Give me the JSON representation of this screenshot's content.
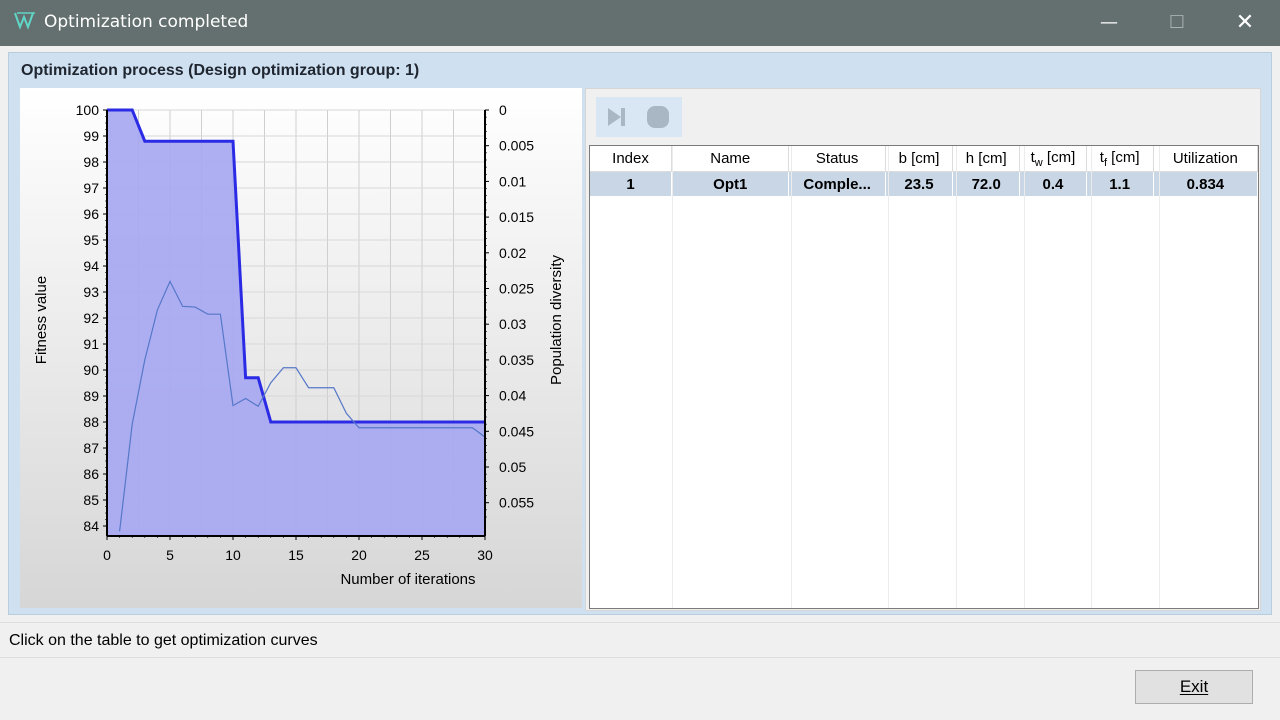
{
  "window": {
    "title": "Optimization completed",
    "minimize_glyph": "—",
    "maximize_glyph": "☐",
    "close_glyph": "✕"
  },
  "group": {
    "title": "Optimization process (Design optimization group: 1)"
  },
  "toolbar": {
    "icons": [
      "step-next-icon",
      "stop-icon"
    ]
  },
  "table": {
    "columns": [
      "Index",
      "Name",
      "Status",
      "b [cm]",
      "h [cm]",
      "tw [cm]",
      "tf [cm]",
      "Utilization"
    ],
    "rows": [
      [
        "1",
        "Opt1",
        "Comple...",
        "23.5",
        "72.0",
        "0.4",
        "1.1",
        "0.834"
      ]
    ]
  },
  "status": {
    "message": "Click on the table to get optimization curves"
  },
  "buttons": {
    "exit": "Exit"
  },
  "colors": {
    "titlebar": "#646f6f",
    "group_bg": "#cfe0f1",
    "fill": "#a7a8f2",
    "fitness_line": "#2b2be6",
    "diversity_line": "#5577c8",
    "selected_row": "#c9d6e5"
  },
  "chart_data": {
    "type": "area",
    "title": "",
    "xlabel": "Number of iterations",
    "ylabel": "Fitness value",
    "y2label": "Population diversity",
    "xlim": [
      0,
      30
    ],
    "ylim": [
      84,
      100
    ],
    "y2lim": [
      0,
      0.058
    ],
    "x_ticks": [
      0,
      5,
      10,
      15,
      20,
      25,
      30
    ],
    "y_ticks": [
      84,
      85,
      86,
      87,
      88,
      89,
      90,
      91,
      92,
      93,
      94,
      95,
      96,
      97,
      98,
      99,
      100
    ],
    "y2_ticks": [
      "0",
      "0.005",
      "0.01",
      "0.015",
      "0.02",
      "0.025",
      "0.03",
      "0.035",
      "0.04",
      "0.045",
      "0.05",
      "0.055"
    ],
    "grid": true,
    "series": [
      {
        "name": "Fitness value",
        "axis": "left",
        "x": [
          0,
          2,
          3,
          10,
          11,
          12,
          13,
          30
        ],
        "y": [
          100,
          100,
          98.8,
          98.8,
          89.7,
          89.7,
          88.0,
          88.0
        ]
      },
      {
        "name": "Population diversity",
        "axis": "right",
        "x": [
          1,
          2,
          3,
          4,
          5,
          6,
          7,
          8,
          9,
          10,
          11,
          12,
          13,
          14,
          15,
          16,
          17,
          18,
          19,
          20,
          25,
          29,
          30
        ],
        "y": [
          0.059,
          0.044,
          0.035,
          0.028,
          0.024,
          0.0275,
          0.0276,
          0.0286,
          0.0286,
          0.0414,
          0.0404,
          0.0415,
          0.0382,
          0.0361,
          0.0361,
          0.0389,
          0.0389,
          0.0389,
          0.0425,
          0.0445,
          0.0445,
          0.0445,
          0.0458
        ]
      }
    ]
  }
}
